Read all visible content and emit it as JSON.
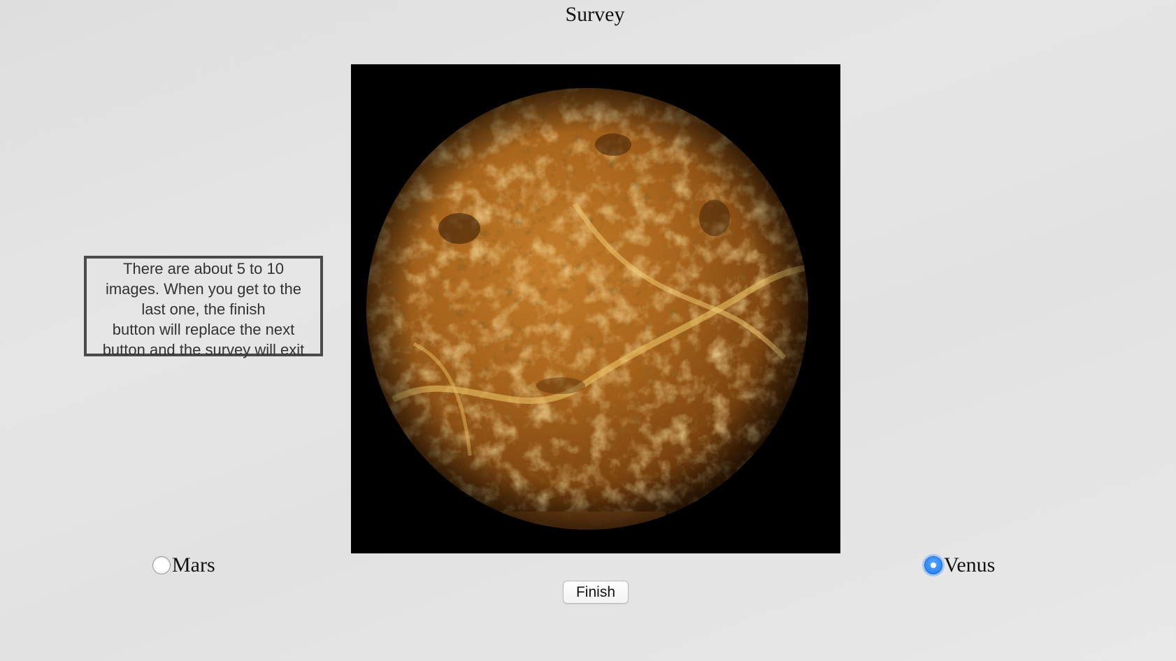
{
  "page": {
    "title": "Survey"
  },
  "info_box": {
    "text": "There are about 5 to 10\nimages.  When you get to the\nlast one, the finish\nbutton will replace the next\nbutton and  the survey will exit"
  },
  "image": {
    "subject": "planet-venus-image"
  },
  "options": [
    {
      "label": "Mars",
      "checked": false
    },
    {
      "label": "Venus",
      "checked": true
    }
  ],
  "buttons": {
    "finish_label": "Finish"
  },
  "colors": {
    "radio_checked": "#2c86f5",
    "info_border": "#4a4a4a",
    "image_background": "#000000",
    "planet_base": "#b06a1c",
    "planet_highlight": "#f0c060"
  }
}
